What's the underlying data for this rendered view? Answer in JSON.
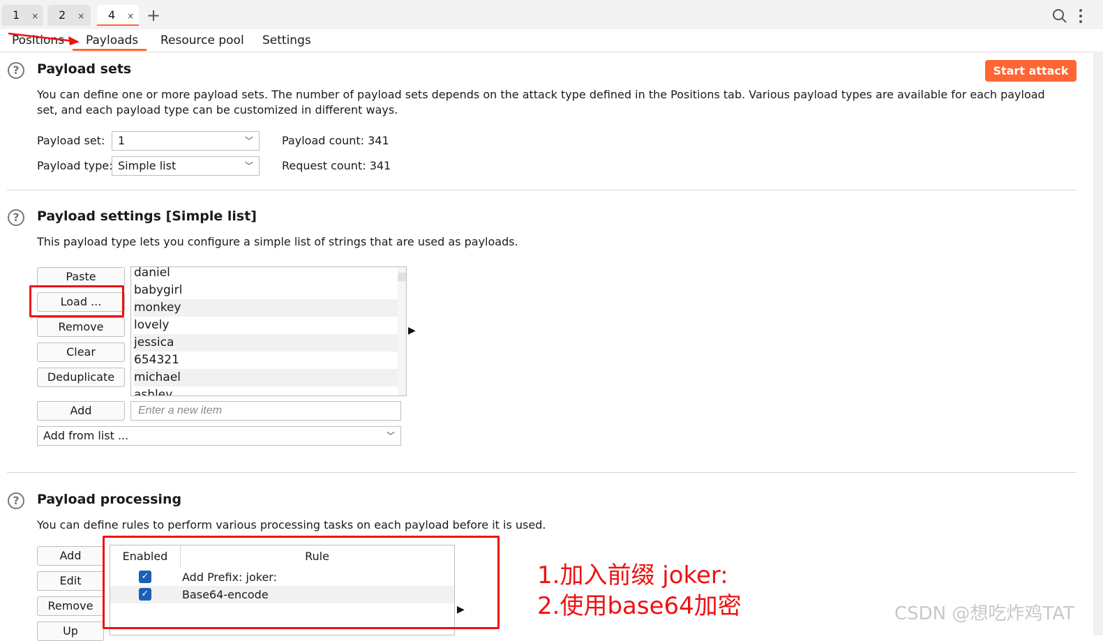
{
  "tabs": [
    {
      "label": "1",
      "close": "×"
    },
    {
      "label": "2",
      "close": "×"
    },
    {
      "label": "4",
      "close": "×"
    }
  ],
  "add_tab": "+",
  "subtabs": [
    "Positions",
    "Payloads",
    "Resource pool",
    "Settings"
  ],
  "payload_sets": {
    "title": "Payload sets",
    "description": "You can define one or more payload sets. The number of payload sets depends on the attack type defined in the Positions tab. Various payload types are available for each payload set, and each payload type can be customized in different ways.",
    "set_label": "Payload set:",
    "set_value": "1",
    "type_label": "Payload type:",
    "type_value": "Simple list",
    "payload_count": "Payload count: 341",
    "request_count": "Request count: 341",
    "start_attack": "Start attack"
  },
  "payload_settings": {
    "title": "Payload settings [Simple list]",
    "description": "This payload type lets you configure a simple list of strings that are used as payloads.",
    "buttons": {
      "paste": "Paste",
      "load": "Load ...",
      "remove": "Remove",
      "clear": "Clear",
      "deduplicate": "Deduplicate",
      "add": "Add"
    },
    "items": [
      "daniel",
      "babygirl",
      "monkey",
      "lovely",
      "jessica",
      "654321",
      "michael",
      "ashley"
    ],
    "new_item_placeholder": "Enter a new item",
    "add_from_list": "Add from list ..."
  },
  "payload_processing": {
    "title": "Payload processing",
    "description": "You can define rules to perform various processing tasks on each payload before it is used.",
    "buttons": {
      "add": "Add",
      "edit": "Edit",
      "remove": "Remove",
      "up": "Up"
    },
    "headers": {
      "enabled": "Enabled",
      "rule": "Rule"
    },
    "rules": [
      {
        "enabled": true,
        "rule": "Add Prefix: joker:"
      },
      {
        "enabled": true,
        "rule": "Base64-encode"
      }
    ]
  },
  "annotation": {
    "line1": "1.加入前缀 joker:",
    "line2": "2.使用base64加密"
  },
  "watermark": "CSDN @想吃炸鸡TAT",
  "colors": {
    "accent": "#ff6633",
    "annotation_red": "#ee1111",
    "checkbox_blue": "#1b5fb8"
  }
}
